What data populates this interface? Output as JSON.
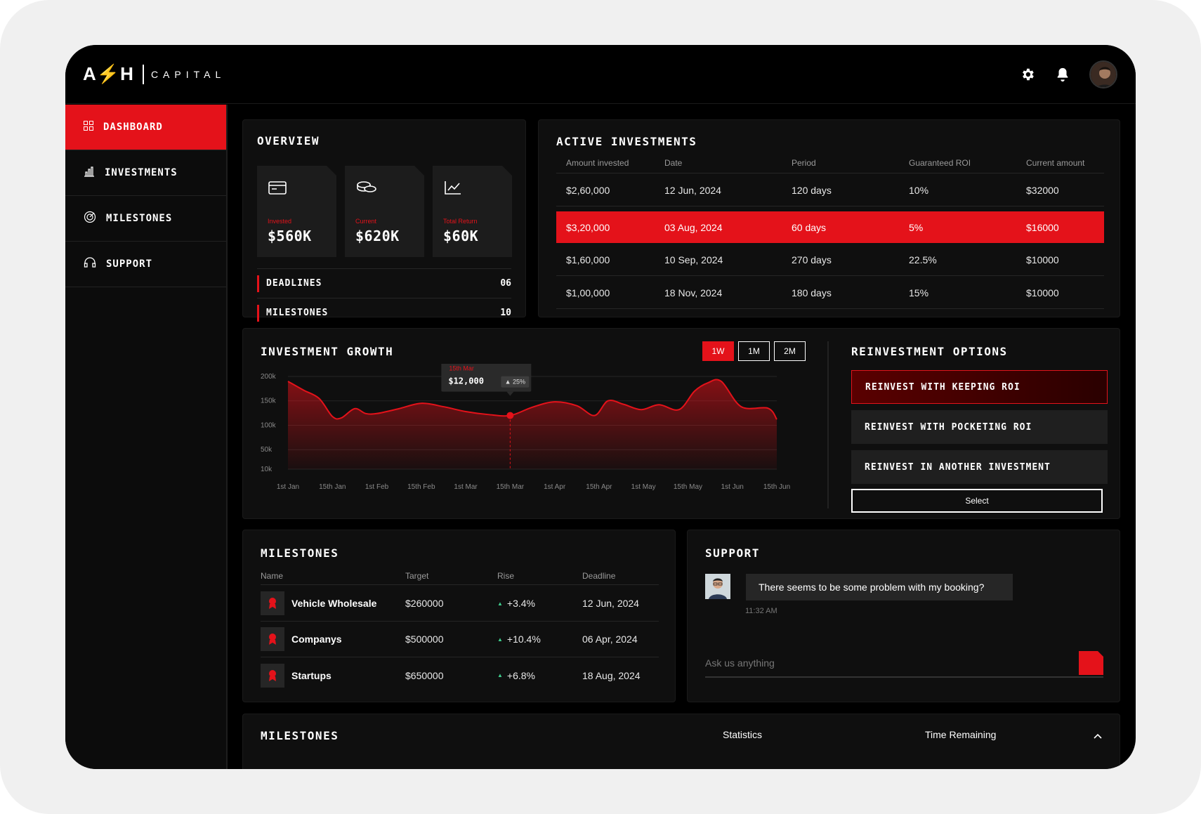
{
  "brand": {
    "mark_left": "A",
    "mark_bolt": "⚡",
    "mark_right": "H",
    "name": "CAPITAL"
  },
  "topbar": {
    "settings_icon": "gear-icon",
    "notification_icon": "bell-icon",
    "avatar": "user-avatar"
  },
  "sidebar": {
    "items": [
      {
        "label": "DASHBOARD",
        "icon": "grid-icon",
        "active": true
      },
      {
        "label": "INVESTMENTS",
        "icon": "bar-chart-icon",
        "active": false
      },
      {
        "label": "MILESTONES",
        "icon": "target-icon",
        "active": false
      },
      {
        "label": "SUPPORT",
        "icon": "headset-icon",
        "active": false
      }
    ]
  },
  "overview": {
    "title": "OVERVIEW",
    "stats": [
      {
        "label": "Invested",
        "value": "$560K",
        "icon": "wallet-icon"
      },
      {
        "label": "Current",
        "value": "$620K",
        "icon": "coins-icon"
      },
      {
        "label": "Total Return",
        "value": "$60K",
        "icon": "trend-icon"
      }
    ],
    "rows": [
      {
        "label": "DEADLINES",
        "value": "06"
      },
      {
        "label": "MILESTONES",
        "value": "10"
      }
    ]
  },
  "active_investments": {
    "title": "ACTIVE INVESTMENTS",
    "columns": [
      "Amount invested",
      "Date",
      "Period",
      "Guaranteed ROI",
      "Current amount"
    ],
    "rows": [
      [
        "$2,60,000",
        "12 Jun, 2024",
        "120 days",
        "10%",
        "$32000"
      ],
      [
        "$3,20,000",
        "03 Aug, 2024",
        "60 days",
        "5%",
        "$16000"
      ],
      [
        "$1,60,000",
        "10 Sep, 2024",
        "270 days",
        "22.5%",
        "$10000"
      ],
      [
        "$1,00,000",
        "18 Nov, 2024",
        "180 days",
        "15%",
        "$10000"
      ]
    ],
    "highlighted_row": 1
  },
  "investment_growth": {
    "title": "INVESTMENT GROWTH",
    "ranges": [
      "1W",
      "1M",
      "2M"
    ],
    "active_range": "1W",
    "tooltip": {
      "date": "15th Mar",
      "value": "$12,000",
      "change": "25%"
    }
  },
  "chart_data": {
    "type": "area",
    "title": "INVESTMENT GROWTH",
    "x": [
      "1st Jan",
      "15th Jan",
      "1st Feb",
      "15th Feb",
      "1st Mar",
      "15th Mar",
      "1st Apr",
      "15th Apr",
      "1st May",
      "15th May",
      "1st Jun",
      "15th Jun"
    ],
    "yticks": [
      "200k",
      "150k",
      "100k",
      "50k",
      "10k"
    ],
    "ylim": [
      10000,
      200000
    ],
    "series": [
      {
        "values": [
          {
            "x": 0.0,
            "y": 190000
          },
          {
            "x": 0.35,
            "y": 172000
          },
          {
            "x": 0.7,
            "y": 155000
          },
          {
            "x": 1.0,
            "y": 118000
          },
          {
            "x": 1.2,
            "y": 115000
          },
          {
            "x": 1.5,
            "y": 134000
          },
          {
            "x": 1.75,
            "y": 124000
          },
          {
            "x": 2.0,
            "y": 124000
          },
          {
            "x": 2.5,
            "y": 134000
          },
          {
            "x": 3.0,
            "y": 145000
          },
          {
            "x": 3.5,
            "y": 138000
          },
          {
            "x": 4.0,
            "y": 128000
          },
          {
            "x": 4.5,
            "y": 122000
          },
          {
            "x": 5.0,
            "y": 120000
          },
          {
            "x": 5.5,
            "y": 137000
          },
          {
            "x": 6.0,
            "y": 148000
          },
          {
            "x": 6.5,
            "y": 140000
          },
          {
            "x": 6.9,
            "y": 120000
          },
          {
            "x": 7.2,
            "y": 150000
          },
          {
            "x": 7.55,
            "y": 143000
          },
          {
            "x": 7.95,
            "y": 132000
          },
          {
            "x": 8.35,
            "y": 142000
          },
          {
            "x": 8.8,
            "y": 132000
          },
          {
            "x": 9.15,
            "y": 170000
          },
          {
            "x": 9.45,
            "y": 187000
          },
          {
            "x": 9.75,
            "y": 190000
          },
          {
            "x": 10.2,
            "y": 138000
          },
          {
            "x": 10.8,
            "y": 135000
          },
          {
            "x": 11.0,
            "y": 112000
          }
        ],
        "color": "#e4121a"
      }
    ],
    "highlight_point": {
      "x": 5.0,
      "y": 120000
    },
    "grid": true
  },
  "reinvestment": {
    "title": "REINVESTMENT OPTIONS",
    "options": [
      "REINVEST WITH KEEPING ROI",
      "REINVEST WITH POCKETING ROI",
      "REINVEST IN ANOTHER INVESTMENT"
    ],
    "selected_index": 0,
    "select_label": "Select"
  },
  "milestones": {
    "title": "MILESTONES",
    "columns": [
      "Name",
      "Target",
      "Rise",
      "Deadline"
    ],
    "rows": [
      {
        "name": "Vehicle Wholesale",
        "target": "$260000",
        "rise": "+3.4%",
        "deadline": "12 Jun, 2024"
      },
      {
        "name": "Companys",
        "target": "$500000",
        "rise": "+10.4%",
        "deadline": "06 Apr, 2024"
      },
      {
        "name": "Startups",
        "target": "$650000",
        "rise": "+6.8%",
        "deadline": "18 Aug, 2024"
      }
    ]
  },
  "support": {
    "title": "SUPPORT",
    "message": "There seems to be some problem with my booking?",
    "time": "11:32 AM",
    "input_placeholder": "Ask us anything"
  },
  "bottom_milestones": {
    "title": "MILESTONES",
    "col_statistics": "Statistics",
    "col_time": "Time Remaining"
  },
  "colors": {
    "accent": "#e4121a",
    "background": "#000000",
    "card": "#0f0f0f"
  }
}
